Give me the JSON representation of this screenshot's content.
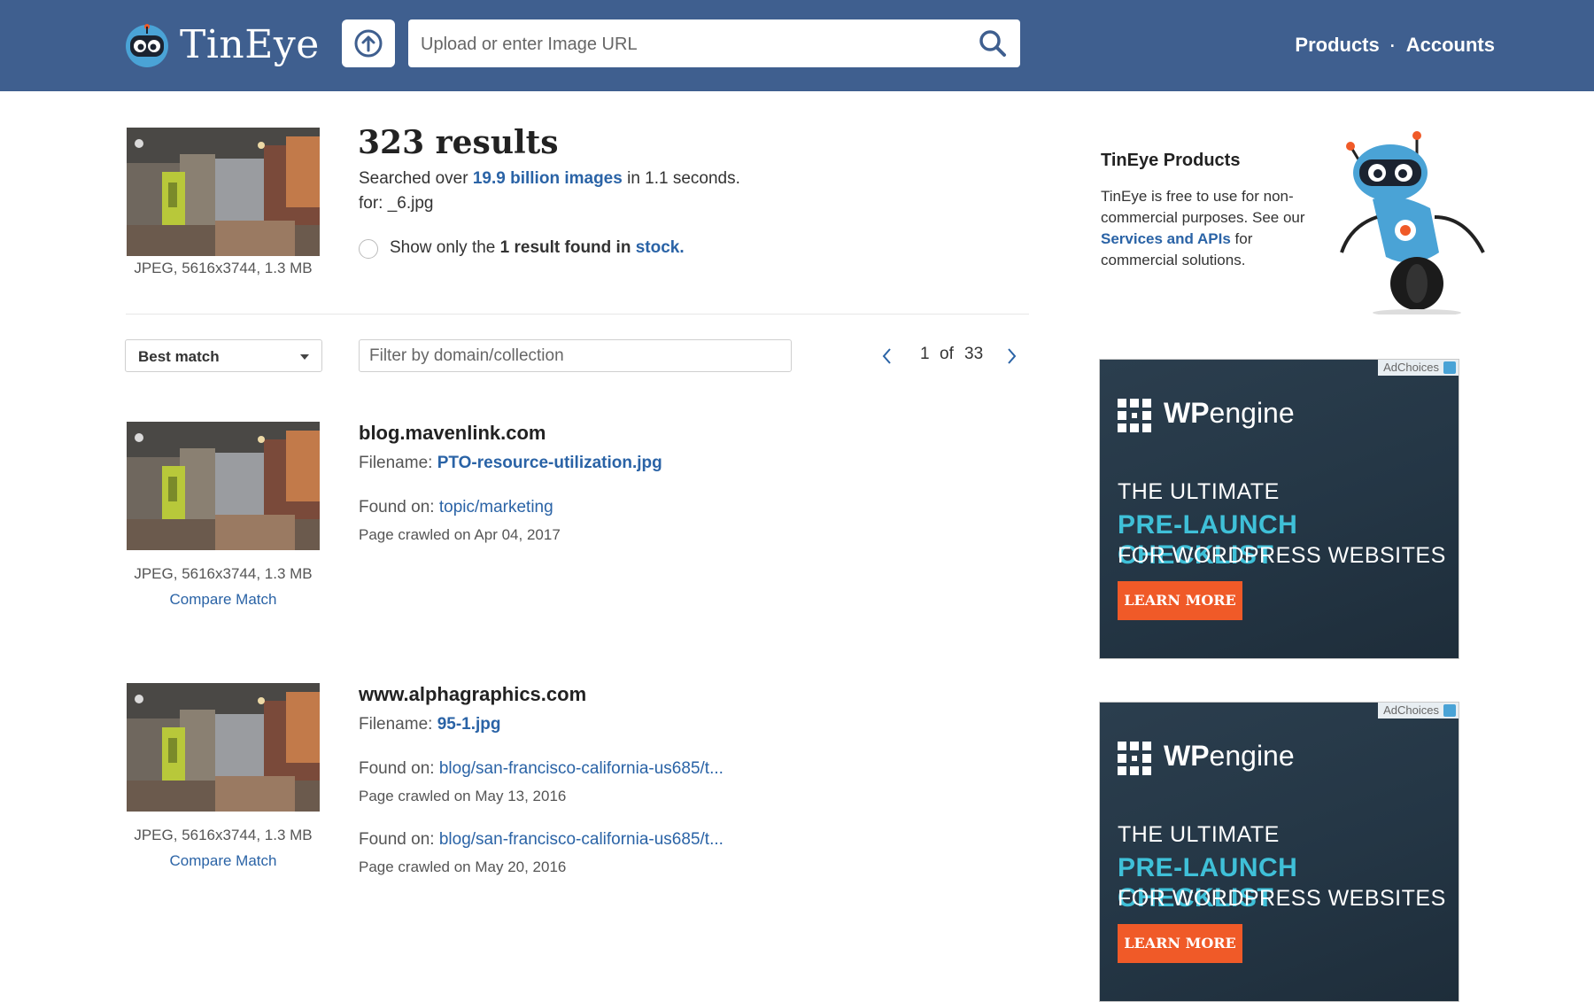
{
  "header": {
    "brand": "TinEye",
    "search_placeholder": "Upload or enter Image URL",
    "nav": {
      "products": "Products",
      "separator": "·",
      "accounts": "Accounts"
    }
  },
  "summary": {
    "count": "323 results",
    "searched_prefix": "Searched over",
    "searched_link": "19.9 billion images",
    "searched_suffix": "in 1.1 seconds.",
    "for_line": "for: _6.jpg",
    "query_meta": "JPEG, 5616x3744, 1.3 MB",
    "stock_prefix": "Show only the",
    "stock_bold": "1 result found in",
    "stock_link": "stock",
    "stock_suffix": "."
  },
  "controls": {
    "sort_selected": "Best match",
    "filter_placeholder": "Filter by domain/collection",
    "page_current": "1",
    "page_of": "of",
    "page_total": "33"
  },
  "results": [
    {
      "domain": "blog.mavenlink.com",
      "filename_label": "Filename:",
      "filename": "PTO-resource-utilization.jpg",
      "meta": "JPEG, 5616x3744, 1.3 MB",
      "compare": "Compare Match",
      "found": [
        {
          "label": "Found on:",
          "link": "topic/marketing",
          "crawled": "Page crawled on Apr 04, 2017"
        }
      ]
    },
    {
      "domain": "www.alphagraphics.com",
      "filename_label": "Filename:",
      "filename": "95-1.jpg",
      "meta": "JPEG, 5616x3744, 1.3 MB",
      "compare": "Compare Match",
      "found": [
        {
          "label": "Found on:",
          "link": "blog/san-francisco-california-us685/t...",
          "crawled": "Page crawled on May 13, 2016"
        },
        {
          "label": "Found on:",
          "link": "blog/san-francisco-california-us685/t...",
          "crawled": "Page crawled on May 20, 2016"
        }
      ]
    }
  ],
  "sidebar": {
    "title": "TinEye Products",
    "text_1": "TinEye is free to use for non-commercial purposes. See our",
    "link": "Services and APIs",
    "text_2": "for commercial solutions."
  },
  "ads": [
    {
      "adchoices": "AdChoices",
      "brand_bold": "WP",
      "brand_light": "engine",
      "line1": "THE ULTIMATE",
      "line2": "PRE-LAUNCH CHECKLIST",
      "line3": "FOR WORDPRESS WEBSITES",
      "cta": "LEARN MORE"
    },
    {
      "adchoices": "AdChoices",
      "brand_bold": "WP",
      "brand_light": "engine",
      "line1": "THE ULTIMATE",
      "line2": "PRE-LAUNCH CHECKLIST",
      "line3": "FOR WORDPRESS WEBSITES",
      "cta": "LEARN MORE"
    }
  ],
  "colors": {
    "header_bg": "#3f5f8f",
    "link": "#2a63a6",
    "ad_accent": "#3fc0d8",
    "ad_cta": "#f05a28"
  },
  "icons": {
    "logo": "tineye-robot-logo-icon",
    "upload": "upload-arrow-icon",
    "search": "search-icon",
    "prev": "chevron-left-icon",
    "next": "chevron-right-icon",
    "sort": "caret-down-icon"
  }
}
